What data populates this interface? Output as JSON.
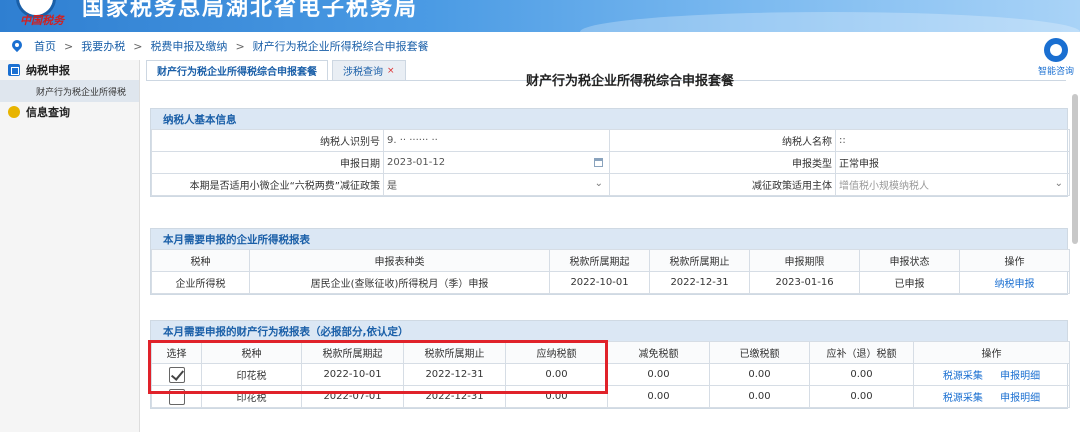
{
  "header": {
    "logo_text": "中国税务",
    "site_title": "国家税务总局湖北省电子税务局"
  },
  "breadcrumb": [
    "首页",
    "我要办税",
    "税费申报及缴纳",
    "财产行为税企业所得税综合申报套餐"
  ],
  "breadcrumb_sep": ">",
  "sidebar": {
    "groups": [
      {
        "label": "纳税申报",
        "items": [
          "财产行为税企业所得税"
        ]
      },
      {
        "label": "信息查询",
        "items": []
      }
    ]
  },
  "tabs": [
    {
      "label": "财产行为税企业所得税综合申报套餐",
      "active": true
    },
    {
      "label": "涉税查询",
      "active": false,
      "close": "×"
    }
  ],
  "page_heading": "财产行为税企业所得税综合申报套餐",
  "assistant": {
    "label": "智能咨询"
  },
  "basic_info": {
    "title": "纳税人基本信息",
    "taxpayer_id_label": "纳税人识别号",
    "taxpayer_id_value": "9. ·· ······ ··",
    "taxpayer_name_label": "纳税人名称",
    "taxpayer_name_value": "::",
    "filing_date_label": "申报日期",
    "filing_date_value": "2023-01-12",
    "filing_type_label": "申报类型",
    "filing_type_value": "正常申报",
    "policy_label": "本期是否适用小微企业“六税两费”减征政策",
    "policy_value": "是",
    "subject_label": "减征政策适用主体",
    "subject_value": "增值税小规模纳税人"
  },
  "cit_table": {
    "title": "本月需要申报的企业所得税报表",
    "headers": [
      "税种",
      "申报表种类",
      "税款所属期起",
      "税款所属期止",
      "申报期限",
      "申报状态",
      "操作"
    ],
    "rows": [
      {
        "tax": "企业所得税",
        "form": "居民企业(查账征收)所得税月（季）申报",
        "start": "2022-10-01",
        "end": "2022-12-31",
        "deadline": "2023-01-16",
        "status": "已申报",
        "action": "纳税申报"
      }
    ]
  },
  "property_table": {
    "title": "本月需要申报的财产行为税报表（必报部分,依认定）",
    "headers": [
      "选择",
      "税种",
      "税款所属期起",
      "税款所属期止",
      "应纳税额",
      "减免税额",
      "已缴税额",
      "应补（退）税额",
      "操作"
    ],
    "rows": [
      {
        "checked": true,
        "tax": "印花税",
        "start": "2022-10-01",
        "end": "2022-12-31",
        "payable": "0.00",
        "relief": "0.00",
        "paid": "0.00",
        "due": "0.00",
        "action1": "税源采集",
        "action2": "申报明细"
      },
      {
        "checked": false,
        "tax": "印花税",
        "start": "2022-07-01",
        "end": "2022-12-31",
        "payable": "0.00",
        "relief": "0.00",
        "paid": "0.00",
        "due": "0.00",
        "action1": "税源采集",
        "action2": "申报明细"
      }
    ]
  },
  "colors": {
    "accent": "#1a6fd1",
    "highlight": "#e0222a",
    "panel_header": "#dbe7f4"
  }
}
